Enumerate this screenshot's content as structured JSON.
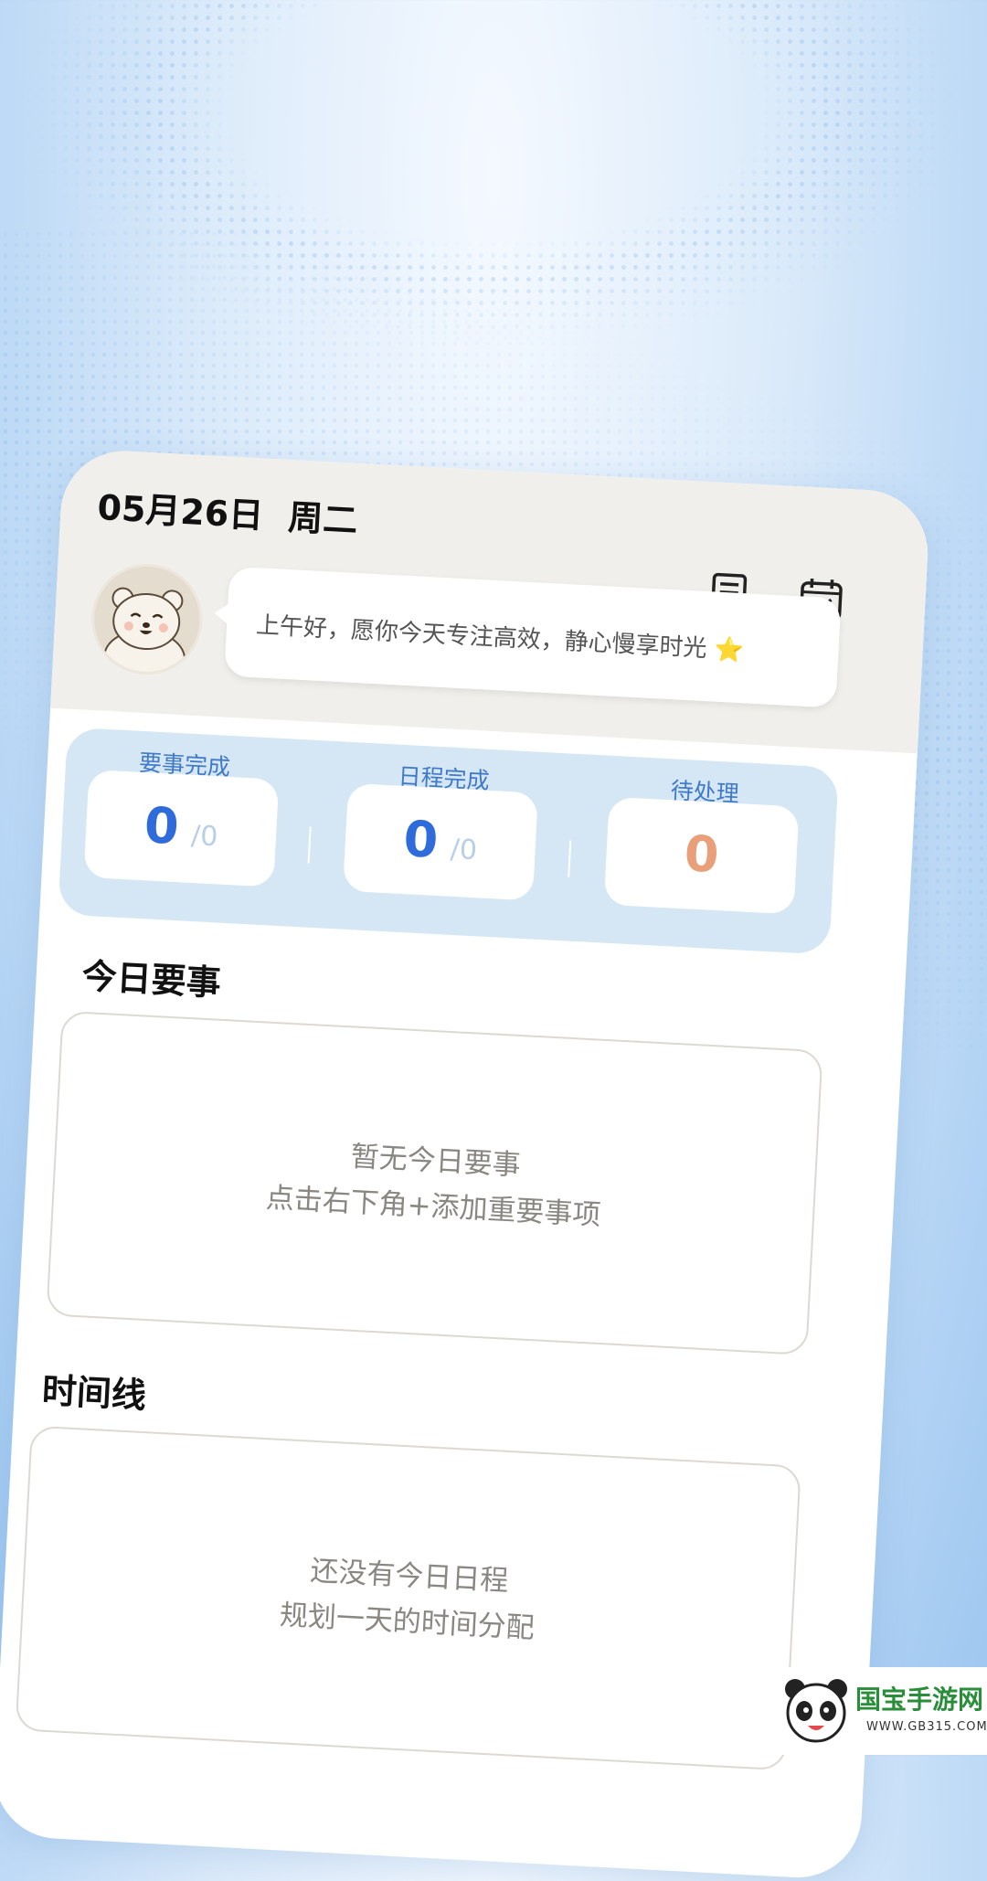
{
  "header": {
    "date": "05月26日",
    "weekday": "周二",
    "greeting": "上午好，愿你今天专注高效，静心慢享时光",
    "greeting_emoji": "⭐"
  },
  "icons": {
    "notes": "notes-icon",
    "calendar": "calendar-check-icon",
    "avatar": "bear-avatar"
  },
  "stats": [
    {
      "label": "要事完成",
      "value": "0",
      "total": "/0"
    },
    {
      "label": "日程完成",
      "value": "0",
      "total": "/0"
    },
    {
      "label": "待处理",
      "value": "0"
    }
  ],
  "important": {
    "title": "今日要事",
    "empty_line1": "暂无今日要事",
    "empty_line2": "点击右下角+添加重要事项"
  },
  "timeline": {
    "title": "时间线",
    "empty_line1": "还没有今日日程",
    "empty_line2": "规划一天的时间分配"
  },
  "watermark": {
    "brand": "国宝手游网",
    "url": "WWW.GB315.COM"
  },
  "colors": {
    "accent_blue": "#2f6bdb",
    "pending_orange": "#e9a07a",
    "stats_bg": "#d5e6f4",
    "header_bg": "#f1efeb"
  }
}
